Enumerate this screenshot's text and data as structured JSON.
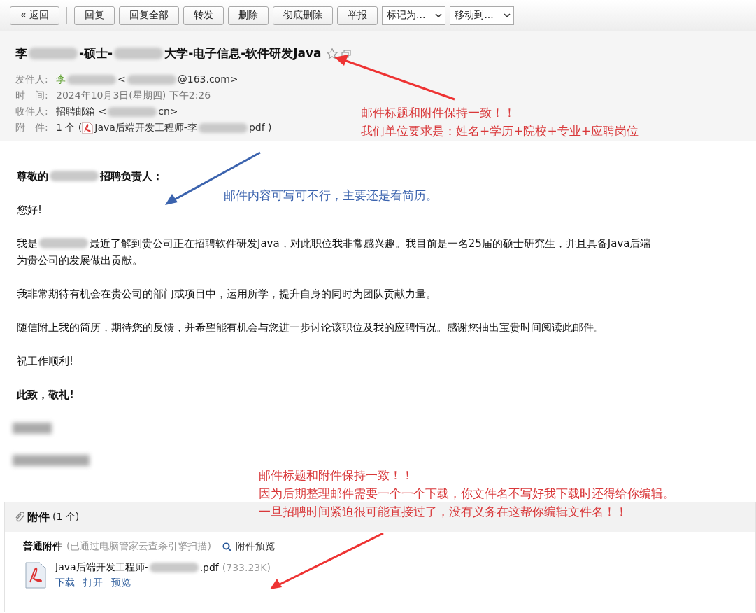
{
  "toolbar": {
    "buttons": [
      {
        "label": "« 返回"
      },
      {
        "label": "回复"
      },
      {
        "label": "回复全部"
      },
      {
        "label": "转发"
      },
      {
        "label": "删除"
      },
      {
        "label": "彻底删除"
      },
      {
        "label": "举报"
      }
    ],
    "selects": [
      {
        "label": "标记为..."
      },
      {
        "label": "移动到..."
      }
    ]
  },
  "header": {
    "subject": [
      {
        "kind": "text",
        "text": "李"
      },
      {
        "kind": "redacted"
      },
      {
        "kind": "text",
        "text": "-硕士-"
      },
      {
        "kind": "redacted"
      },
      {
        "kind": "text",
        "text": "大学-电子信息-软件研发Java"
      }
    ],
    "starred": false,
    "fields": [
      {
        "label": "发件人:",
        "value": [
          {
            "kind": "name",
            "text": "李"
          },
          {
            "kind": "redacted"
          },
          {
            "kind": "text",
            "text": "<"
          },
          {
            "kind": "redacted"
          },
          {
            "kind": "text",
            "text": "@163.com>"
          }
        ]
      },
      {
        "label": "时　间:",
        "value": [
          {
            "kind": "muted",
            "text": "2024年10月3日(星期四) 下午2:26"
          }
        ]
      },
      {
        "label": "收件人:",
        "value": [
          {
            "kind": "text",
            "text": "招聘邮箱 <"
          },
          {
            "kind": "redacted"
          },
          {
            "kind": "text",
            "text": "cn>"
          }
        ]
      },
      {
        "label": "附　件:",
        "value": [
          {
            "kind": "text",
            "text": "1 个 ("
          },
          {
            "kind": "pdf"
          },
          {
            "kind": "text",
            "text": "Java后端开发工程师-李"
          },
          {
            "kind": "redacted"
          },
          {
            "kind": "text",
            "text": "pdf )"
          }
        ]
      }
    ]
  },
  "body": {
    "greeting": [
      {
        "kind": "text",
        "text": "尊敬的"
      },
      {
        "kind": "redacted"
      },
      {
        "kind": "text",
        "text": "招聘负责人："
      }
    ],
    "paragraphs": [
      {
        "lines": [
          [
            {
              "kind": "text",
              "text": "您好!"
            }
          ]
        ]
      },
      {
        "lines": [
          [
            {
              "kind": "text",
              "text": "我是"
            },
            {
              "kind": "redacted"
            },
            {
              "kind": "text",
              "text": "最近了解到贵公司正在招聘软件研发Java，对此职位我非常感兴趣。我目前是一名25届的硕士研究生，并且具备Java后端"
            }
          ],
          [
            {
              "kind": "text",
              "text": "为贵公司的发展做出贡献。"
            }
          ]
        ]
      },
      {
        "lines": [
          [
            {
              "kind": "text",
              "text": "我非常期待有机会在贵公司的部门或项目中，运用所学，提升自身的同时为团队贡献力量。"
            }
          ]
        ]
      },
      {
        "lines": [
          [
            {
              "kind": "text",
              "text": "随信附上我的简历，期待您的反馈，并希望能有机会与您进一步讨论该职位及我的应聘情况。感谢您抽出宝贵时间阅读此邮件。"
            }
          ]
        ]
      },
      {
        "lines": [
          [
            {
              "kind": "text",
              "text": "祝工作顺利!"
            }
          ]
        ]
      }
    ],
    "closing": "此致，敬礼!"
  },
  "attachments": {
    "title": "附件",
    "count": "(1 个)",
    "group_label": "普通附件",
    "scan_note": "(已通过电脑管家云查杀引擎扫描)",
    "preview_link": "附件预览",
    "files": [
      {
        "name_parts": [
          {
            "kind": "text",
            "text": "Java后端开发工程师-"
          },
          {
            "kind": "redacted"
          },
          {
            "kind": "text",
            "text": ".pdf"
          }
        ],
        "size": "(733.23K)",
        "actions": [
          "下载",
          "打开",
          "预览"
        ]
      }
    ]
  },
  "annotations": [
    {
      "kind": "red",
      "lines": [
        "邮件标题和附件保持一致！！",
        "我们单位要求是：姓名+学历+院校+专业+应聘岗位"
      ]
    },
    {
      "kind": "blue",
      "lines": [
        "邮件内容可写可不行，主要还是看简历。"
      ]
    },
    {
      "kind": "red",
      "lines": [
        "邮件标题和附件保持一致！！",
        "因为后期整理邮件需要一个一个下载，你文件名不写好我下载时还得给你编辑。",
        "一旦招聘时间紧迫很可能直接过了，没有义务在这帮你编辑文件名！！"
      ]
    }
  ]
}
